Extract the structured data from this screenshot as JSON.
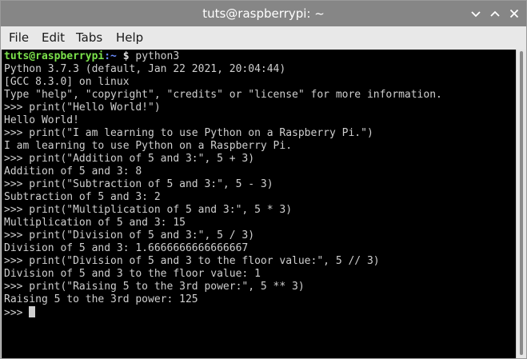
{
  "window": {
    "title": "tuts@raspberrypi: ~"
  },
  "menu": {
    "file": "File",
    "edit": "Edit",
    "tabs": "Tabs",
    "help": "Help"
  },
  "terminal": {
    "prompt_user": "tuts@raspberrypi",
    "prompt_path": ":~",
    "prompt_symbol": " $",
    "prompt_command": " python3",
    "lines": [
      "Python 3.7.3 (default, Jan 22 2021, 20:04:44)",
      "[GCC 8.3.0] on linux",
      "Type \"help\", \"copyright\", \"credits\" or \"license\" for more information.",
      ">>> print(\"Hello World!\")",
      "Hello World!",
      ">>> print(\"I am learning to use Python on a Raspberry Pi.\")",
      "I am learning to use Python on a Raspberry Pi.",
      ">>> print(\"Addition of 5 and 3:\", 5 + 3)",
      "Addition of 5 and 3: 8",
      ">>> print(\"Subtraction of 5 and 3:\", 5 - 3)",
      "Subtraction of 5 and 3: 2",
      ">>> print(\"Multiplication of 5 and 3:\", 5 * 3)",
      "Multiplication of 5 and 3: 15",
      ">>> print(\"Division of 5 and 3:\", 5 / 3)",
      "Division of 5 and 3: 1.6666666666666667",
      ">>> print(\"Division of 5 and 3 to the floor value:\", 5 // 3)",
      "Division of 5 and 3 to the floor value: 1",
      ">>> print(\"Raising 5 to the 3rd power:\", 5 ** 3)",
      "Raising 5 to the 3rd power: 125"
    ],
    "last_prompt": ">>> "
  },
  "icons": {
    "menu": "chevron-down-icon",
    "maximize": "chevron-up-icon",
    "close": "close-icon"
  },
  "colors": {
    "titlebar": "#868686",
    "terminal_bg": "#000000",
    "terminal_fg": "#cfcfcf",
    "prompt_user": "#7be24b",
    "prompt_path": "#6b8cff"
  }
}
